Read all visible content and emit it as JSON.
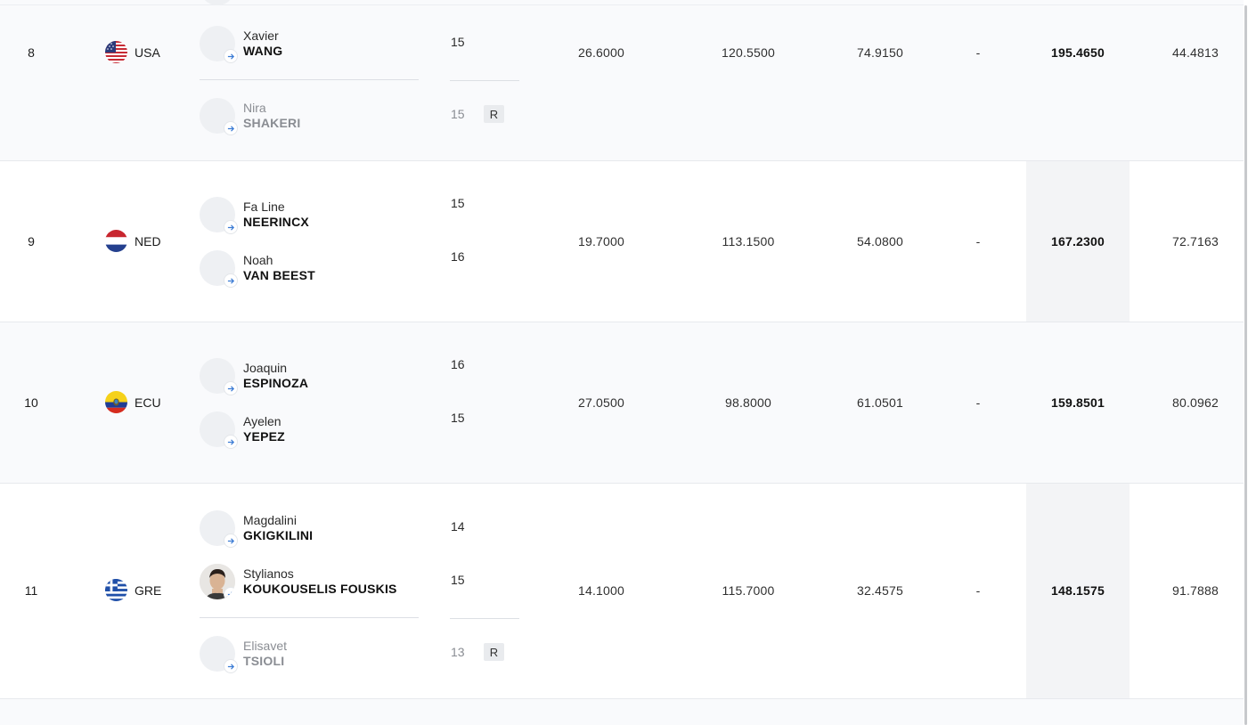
{
  "rows": [
    {
      "rank": "8",
      "noc": "USA",
      "flag": "usa",
      "athletes": [
        {
          "first": "Xavier",
          "last": "WANG",
          "age": "15",
          "reserve": false
        },
        {
          "first": "Nira",
          "last": "SHAKERI",
          "age": "15",
          "reserve": true,
          "badge": "R"
        }
      ],
      "scores": [
        "26.6000",
        "120.5500",
        "74.9150",
        "-",
        "195.4650",
        "44.4813"
      ]
    },
    {
      "rank": "9",
      "noc": "NED",
      "flag": "ned",
      "athletes": [
        {
          "first": "Fa Line",
          "last": "NEERINCX",
          "age": "15",
          "reserve": false
        },
        {
          "first": "Noah",
          "last": "VAN BEEST",
          "age": "16",
          "reserve": false
        }
      ],
      "scores": [
        "19.7000",
        "113.1500",
        "54.0800",
        "-",
        "167.2300",
        "72.7163"
      ]
    },
    {
      "rank": "10",
      "noc": "ECU",
      "flag": "ecu",
      "athletes": [
        {
          "first": "Joaquin",
          "last": "ESPINOZA",
          "age": "16",
          "reserve": false
        },
        {
          "first": "Ayelen",
          "last": "YEPEZ",
          "age": "15",
          "reserve": false
        }
      ],
      "scores": [
        "27.0500",
        "98.8000",
        "61.0501",
        "-",
        "159.8501",
        "80.0962"
      ]
    },
    {
      "rank": "11",
      "noc": "GRE",
      "flag": "gre",
      "athletes": [
        {
          "first": "Magdalini",
          "last": "GKIGKILINI",
          "age": "14",
          "reserve": false
        },
        {
          "first": "Stylianos",
          "last": "KOUKOUSELIS FOUSKIS",
          "age": "15",
          "reserve": false,
          "photo": true
        },
        {
          "first": "Elisavet",
          "last": "TSIOLI",
          "age": "13",
          "reserve": true,
          "badge": "R"
        }
      ],
      "scores": [
        "14.1000",
        "115.7000",
        "32.4575",
        "-",
        "148.1575",
        "91.7888"
      ]
    }
  ],
  "colors": {
    "row_shade": "#f9fafc",
    "total_column": "#f3f4f6",
    "reserve_text": "#8a8d93"
  }
}
